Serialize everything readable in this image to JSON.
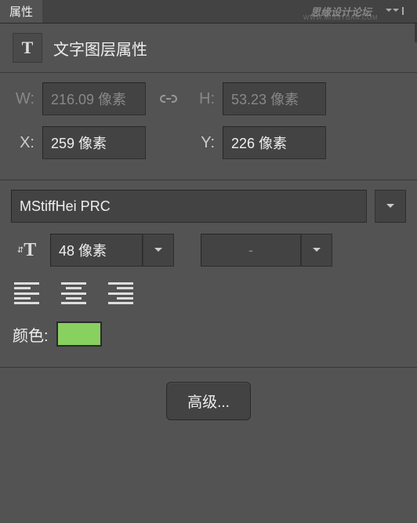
{
  "tab": {
    "title": "属性"
  },
  "watermark": {
    "text": "思缘设计论坛",
    "sub": "WWW.MISSYUAN.COM"
  },
  "header": {
    "icon_letter": "T",
    "title": "文字图层属性"
  },
  "dims": {
    "w_label": "W:",
    "w_value": "216.09 像素",
    "h_label": "H:",
    "h_value": "53.23 像素",
    "x_label": "X:",
    "x_value": "259 像素",
    "y_label": "Y:",
    "y_value": "226 像素"
  },
  "font": {
    "family": "MStiffHei PRC",
    "size": "48 像素",
    "leading": "-"
  },
  "color": {
    "label": "颜色:",
    "value": "#88d060"
  },
  "advanced": {
    "label": "高级..."
  }
}
